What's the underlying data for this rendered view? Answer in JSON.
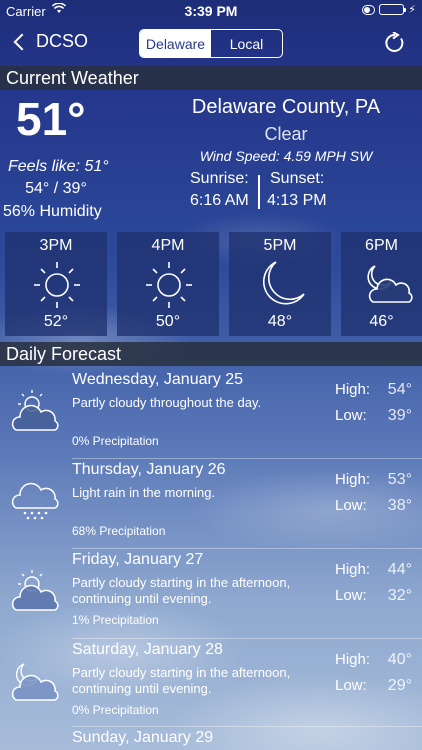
{
  "status": {
    "carrier": "Carrier",
    "time": "3:39 PM"
  },
  "nav": {
    "back_label": "DCSO",
    "tabs": [
      "Delaware",
      "Local"
    ]
  },
  "current": {
    "header": "Current Weather",
    "temp": "51°",
    "feels_like": "Feels like: 51°",
    "hi_lo": "54° / 39°",
    "humidity": "56% Humidity",
    "location": "Delaware County, PA",
    "condition": "Clear",
    "wind": "Wind Speed: 4.59 MPH SW",
    "sunrise_label": "Sunrise:",
    "sunrise": "6:16 AM",
    "sunset_label": "Sunset:",
    "sunset": "4:13 PM"
  },
  "hourly": [
    {
      "hour": "3PM",
      "temp": "52°",
      "icon": "sun-icon"
    },
    {
      "hour": "4PM",
      "temp": "50°",
      "icon": "sun-icon"
    },
    {
      "hour": "5PM",
      "temp": "48°",
      "icon": "moon-icon"
    },
    {
      "hour": "6PM",
      "temp": "46°",
      "icon": "moon-cloud-icon"
    }
  ],
  "daily": {
    "header": "Daily Forecast",
    "high_label": "High:",
    "low_label": "Low:",
    "days": [
      {
        "name": "Wednesday, January 25",
        "summary": "Partly cloudy throughout the day.",
        "precip": "0% Precipitation",
        "high": "54°",
        "low": "39°",
        "icon": "partly-cloudy-day-icon"
      },
      {
        "name": "Thursday, January 26",
        "summary": "Light rain in the morning.",
        "precip": "68% Precipitation",
        "high": "53°",
        "low": "38°",
        "icon": "rain-icon"
      },
      {
        "name": "Friday, January 27",
        "summary": "Partly cloudy starting in the afternoon, continuing until evening.",
        "precip": "1% Precipitation",
        "high": "44°",
        "low": "32°",
        "icon": "partly-cloudy-day-icon"
      },
      {
        "name": "Saturday, January 28",
        "summary": "Partly cloudy starting in the afternoon, continuing until evening.",
        "precip": "0% Precipitation",
        "high": "40°",
        "low": "29°",
        "icon": "partly-cloudy-night-icon"
      },
      {
        "name": "Sunday, January 29",
        "summary": "",
        "precip": "",
        "high": "",
        "low": "",
        "icon": ""
      }
    ]
  }
}
